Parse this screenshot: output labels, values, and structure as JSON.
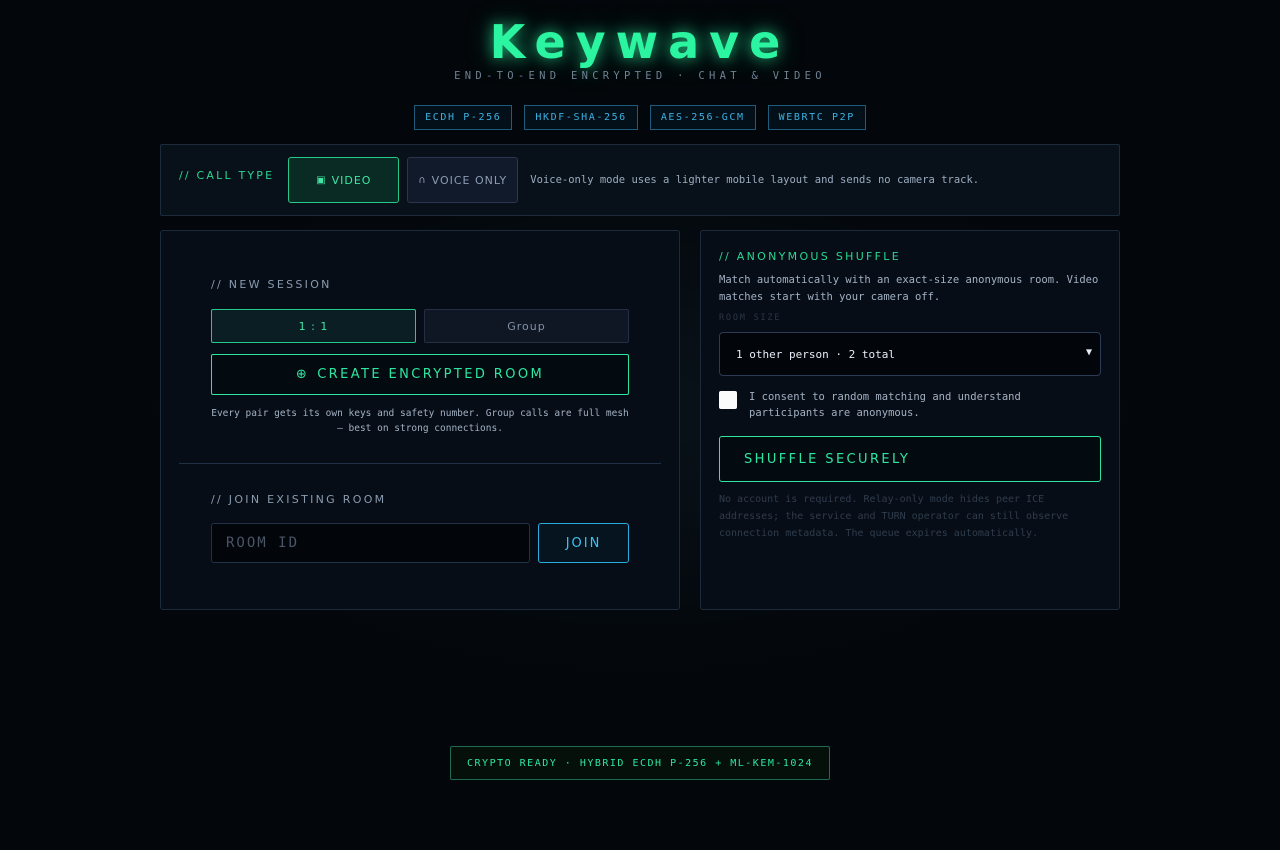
{
  "header": {
    "logo": "Keywave",
    "tagline": "END-TO-END ENCRYPTED · CHAT & VIDEO"
  },
  "chips": [
    "ECDH P-256",
    "HKDF-SHA-256",
    "AES-256-GCM",
    "WEBRTC P2P"
  ],
  "call_type": {
    "label": "// CALL TYPE",
    "video_icon": "camera-icon",
    "video_label": "VIDEO",
    "voice_icon": "headphones-icon",
    "voice_label": "VOICE ONLY",
    "hint": "Voice-only mode uses a lighter mobile layout and sends no camera track."
  },
  "new_session": {
    "title": "// NEW SESSION",
    "mode_one": "1 : 1",
    "mode_group": "Group",
    "create_icon": "plus-circle-icon",
    "create_label": "CREATE ENCRYPTED ROOM",
    "note": "Every pair gets its own keys and safety number. Group calls are full mesh — best on strong connections."
  },
  "join": {
    "title": "// JOIN EXISTING ROOM",
    "placeholder": "ROOM ID",
    "value": "",
    "button": "JOIN"
  },
  "shuffle": {
    "title": "// ANONYMOUS SHUFFLE",
    "description": "Match automatically with an exact-size anonymous room. Video matches start with your camera off.",
    "room_size_label": "ROOM SIZE",
    "room_size_value": "1 other person · 2 total",
    "consent": "I consent to random matching and understand participants are anonymous.",
    "consent_checked": false,
    "button": "SHUFFLE SECURELY",
    "fine_print": "No account is required. Relay-only mode hides peer ICE addresses; the service and TURN operator can still observe connection metadata. The queue expires automatically."
  },
  "footer": {
    "status": "CRYPTO READY · HYBRID ECDH P-256 + ML-KEM-1024"
  },
  "colors": {
    "accent_green": "#2ee6a0",
    "accent_blue": "#3bc3f0",
    "background": "#03060a"
  }
}
